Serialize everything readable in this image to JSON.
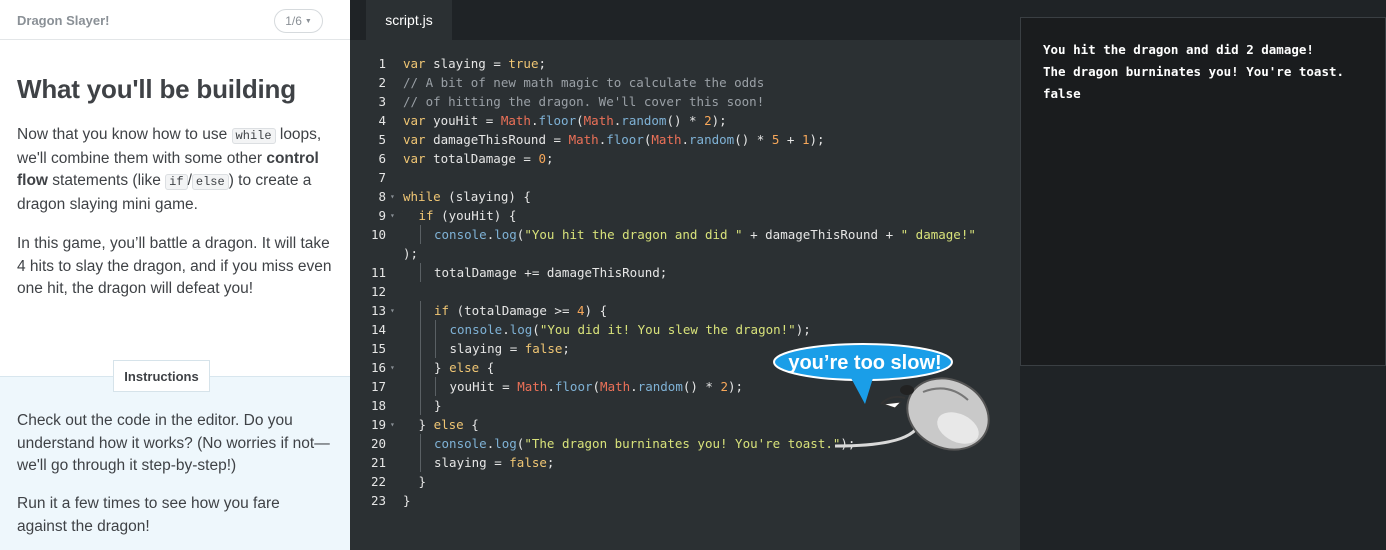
{
  "lesson": {
    "course_title": "Dragon Slayer!",
    "page_indicator": "1/6",
    "heading": "What you'll be building",
    "p1": {
      "a": "Now that you know how to use ",
      "code_while": "while",
      "b": " loops, we'll combine them with some other ",
      "bold": "control flow",
      "c": " statements (like ",
      "code_if": "if",
      "slash": "/",
      "code_else": "else",
      "d": ") to create a dragon slaying mini game."
    },
    "p2": "In this game, you’ll battle a dragon. It will take 4 hits to slay the dragon, and if you miss even one hit, the dragon will defeat you!",
    "instructions_tab": "Instructions",
    "p3": "Check out the code in the editor. Do you understand how it works? (No worries if not—we'll go through it step-by-step!)",
    "p4": "Run it a few times to see how you fare against the dragon!"
  },
  "editor": {
    "tab": "script.js",
    "lines": [
      {
        "n": "1",
        "fold": false,
        "indent": 0,
        "parts": [
          [
            "kw",
            "var"
          ],
          [
            "p",
            " slaying "
          ],
          [
            "p",
            "= "
          ],
          [
            "kw",
            "true"
          ],
          [
            "p",
            ";"
          ]
        ]
      },
      {
        "n": "2",
        "fold": false,
        "indent": 0,
        "parts": [
          [
            "cm",
            "// A bit of new math magic to calculate the odds"
          ]
        ]
      },
      {
        "n": "3",
        "fold": false,
        "indent": 0,
        "parts": [
          [
            "cm",
            "// of hitting the dragon. We'll cover this soon!"
          ]
        ]
      },
      {
        "n": "4",
        "fold": false,
        "indent": 0,
        "parts": [
          [
            "kw",
            "var"
          ],
          [
            "p",
            " youHit = "
          ],
          [
            "obj",
            "Math"
          ],
          [
            "p",
            "."
          ],
          [
            "prop",
            "floor"
          ],
          [
            "p",
            "("
          ],
          [
            "obj",
            "Math"
          ],
          [
            "p",
            "."
          ],
          [
            "prop",
            "random"
          ],
          [
            "p",
            "() * "
          ],
          [
            "num",
            "2"
          ],
          [
            "p",
            ");"
          ]
        ]
      },
      {
        "n": "5",
        "fold": false,
        "indent": 0,
        "parts": [
          [
            "kw",
            "var"
          ],
          [
            "p",
            " damageThisRound = "
          ],
          [
            "obj",
            "Math"
          ],
          [
            "p",
            "."
          ],
          [
            "prop",
            "floor"
          ],
          [
            "p",
            "("
          ],
          [
            "obj",
            "Math"
          ],
          [
            "p",
            "."
          ],
          [
            "prop",
            "random"
          ],
          [
            "p",
            "() * "
          ],
          [
            "num",
            "5"
          ],
          [
            "p",
            " + "
          ],
          [
            "num",
            "1"
          ],
          [
            "p",
            ");"
          ]
        ]
      },
      {
        "n": "6",
        "fold": false,
        "indent": 0,
        "parts": [
          [
            "kw",
            "var"
          ],
          [
            "p",
            " totalDamage = "
          ],
          [
            "num",
            "0"
          ],
          [
            "p",
            ";"
          ]
        ]
      },
      {
        "n": "7",
        "fold": false,
        "indent": 0,
        "parts": []
      },
      {
        "n": "8",
        "fold": true,
        "indent": 0,
        "parts": [
          [
            "kw",
            "while"
          ],
          [
            "p",
            " (slaying) {"
          ]
        ]
      },
      {
        "n": "9",
        "fold": true,
        "indent": 1,
        "parts": [
          [
            "kw",
            "if"
          ],
          [
            "p",
            " (youHit) {"
          ]
        ]
      },
      {
        "n": "10",
        "fold": false,
        "indent": 2,
        "parts": [
          [
            "prop",
            "console"
          ],
          [
            "p",
            "."
          ],
          [
            "prop",
            "log"
          ],
          [
            "p",
            "("
          ],
          [
            "str",
            "\"You hit the dragon and did \""
          ],
          [
            "p",
            " + damageThisRound + "
          ],
          [
            "str",
            "\" damage!\""
          ]
        ]
      },
      {
        "n": "",
        "fold": false,
        "indent": 0,
        "parts": [
          [
            "p",
            ");"
          ]
        ]
      },
      {
        "n": "11",
        "fold": false,
        "indent": 2,
        "parts": [
          [
            "p",
            "totalDamage += damageThisRound;"
          ]
        ]
      },
      {
        "n": "12",
        "fold": false,
        "indent": 0,
        "parts": []
      },
      {
        "n": "13",
        "fold": true,
        "indent": 2,
        "parts": [
          [
            "kw",
            "if"
          ],
          [
            "p",
            " (totalDamage >= "
          ],
          [
            "num",
            "4"
          ],
          [
            "p",
            ") {"
          ]
        ]
      },
      {
        "n": "14",
        "fold": false,
        "indent": 3,
        "parts": [
          [
            "prop",
            "console"
          ],
          [
            "p",
            "."
          ],
          [
            "prop",
            "log"
          ],
          [
            "p",
            "("
          ],
          [
            "str",
            "\"You did it! You slew the dragon!\""
          ],
          [
            "p",
            ");"
          ]
        ]
      },
      {
        "n": "15",
        "fold": false,
        "indent": 3,
        "parts": [
          [
            "p",
            "slaying = "
          ],
          [
            "kw",
            "false"
          ],
          [
            "p",
            ";"
          ]
        ]
      },
      {
        "n": "16",
        "fold": true,
        "indent": 2,
        "parts": [
          [
            "p",
            "} "
          ],
          [
            "kw",
            "else"
          ],
          [
            "p",
            " {"
          ]
        ]
      },
      {
        "n": "17",
        "fold": false,
        "indent": 3,
        "parts": [
          [
            "p",
            "youHit = "
          ],
          [
            "obj",
            "Math"
          ],
          [
            "p",
            "."
          ],
          [
            "prop",
            "floor"
          ],
          [
            "p",
            "("
          ],
          [
            "obj",
            "Math"
          ],
          [
            "p",
            "."
          ],
          [
            "prop",
            "random"
          ],
          [
            "p",
            "() * "
          ],
          [
            "num",
            "2"
          ],
          [
            "p",
            ");"
          ]
        ]
      },
      {
        "n": "18",
        "fold": false,
        "indent": 2,
        "parts": [
          [
            "p",
            "}"
          ]
        ]
      },
      {
        "n": "19",
        "fold": true,
        "indent": 1,
        "parts": [
          [
            "p",
            "} "
          ],
          [
            "kw",
            "else"
          ],
          [
            "p",
            " {"
          ]
        ]
      },
      {
        "n": "20",
        "fold": false,
        "indent": 2,
        "parts": [
          [
            "prop",
            "console"
          ],
          [
            "p",
            "."
          ],
          [
            "prop",
            "log"
          ],
          [
            "p",
            "("
          ],
          [
            "str",
            "\"The dragon burninates you! You're toast.\""
          ],
          [
            "p",
            ");"
          ]
        ]
      },
      {
        "n": "21",
        "fold": false,
        "indent": 2,
        "parts": [
          [
            "p",
            "slaying = "
          ],
          [
            "kw",
            "false"
          ],
          [
            "p",
            ";"
          ]
        ]
      },
      {
        "n": "22",
        "fold": false,
        "indent": 1,
        "parts": [
          [
            "p",
            "}"
          ]
        ]
      },
      {
        "n": "23",
        "fold": false,
        "indent": 0,
        "parts": [
          [
            "p",
            "}"
          ]
        ]
      }
    ]
  },
  "output": {
    "lines": [
      "You hit the dragon and did 2 damage!",
      "The dragon burninates you! You're toast.",
      "false"
    ]
  },
  "sticker": {
    "bubble_text": "you’re too slow!"
  },
  "colors": {
    "editor_bg": "#2b3033",
    "output_bg": "#1a1c1e",
    "keyword": "#f0c674",
    "string": "#d8e27a",
    "number": "#f6a75a",
    "bubble": "#1a9ee8"
  }
}
